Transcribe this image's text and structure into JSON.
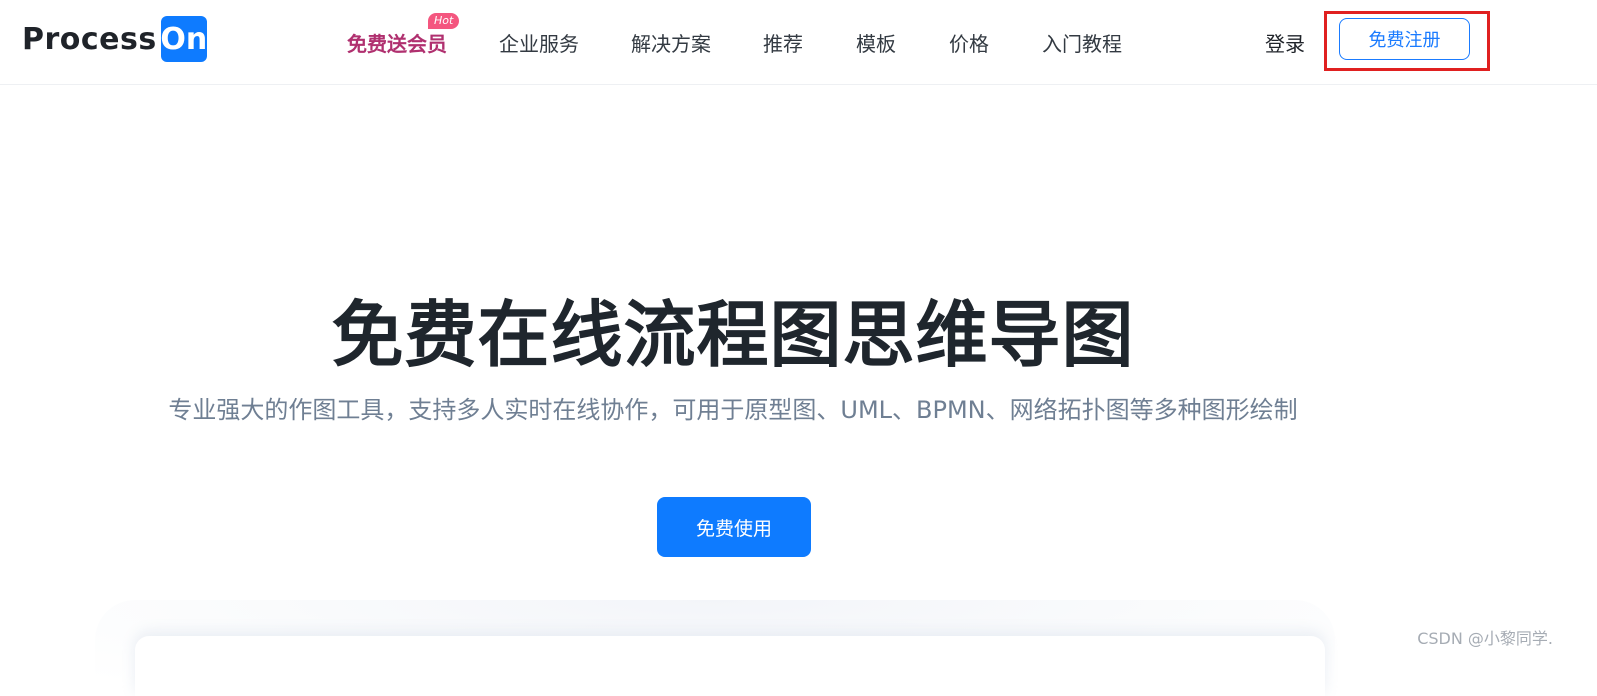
{
  "header": {
    "logo": {
      "text": "Process",
      "box_text": "On"
    },
    "nav": [
      {
        "label": "免费送会员",
        "badge": "Hot"
      },
      {
        "label": "企业服务"
      },
      {
        "label": "解决方案"
      },
      {
        "label": "推荐"
      },
      {
        "label": "模板"
      },
      {
        "label": "价格"
      },
      {
        "label": "入门教程"
      }
    ],
    "login_label": "登录",
    "register_label": "免费注册"
  },
  "hero": {
    "title": "免费在线流程图思维导图",
    "subtitle": "专业强大的作图工具，支持多人实时在线协作，可用于原型图、UML、BPMN、网络拓扑图等多种图形绘制",
    "cta_label": "免费使用"
  },
  "watermark": "CSDN @小黎同学.",
  "colors": {
    "brand_blue": "#0e7bff",
    "promo": "#b0306f",
    "hot_badge": "#f4567f",
    "highlight_box": "#e02020"
  }
}
